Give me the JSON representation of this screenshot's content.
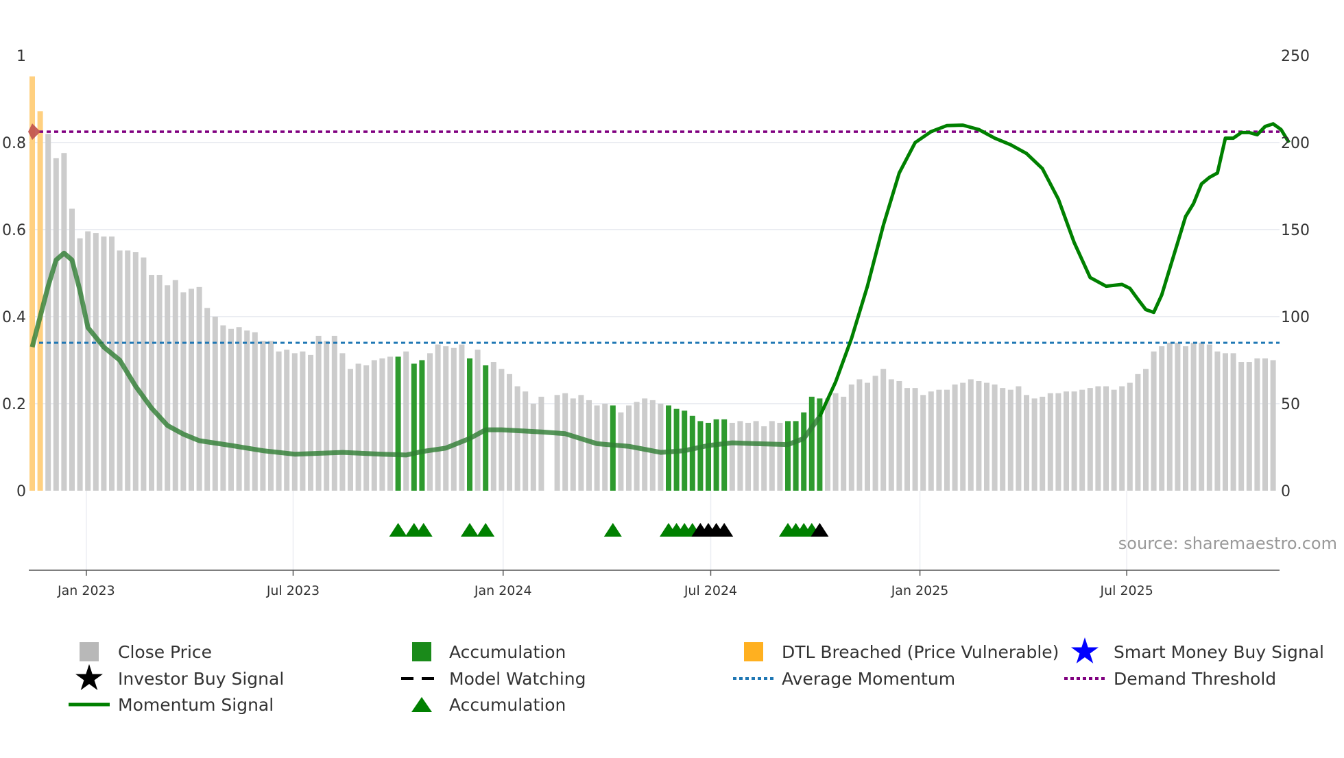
{
  "chart_data": {
    "type": "bar+line",
    "source": "source: sharemaestro.com",
    "left_axis": {
      "range": [
        0,
        1
      ],
      "ticks": [
        "0",
        "0.2",
        "0.4",
        "0.6",
        "0.8",
        "1"
      ],
      "tick_values": [
        0,
        0.2,
        0.4,
        0.6,
        0.8,
        1
      ]
    },
    "right_axis": {
      "range": [
        0,
        250
      ],
      "ticks": [
        "0",
        "50",
        "100",
        "150",
        "200",
        "250"
      ],
      "tick_values": [
        0,
        50,
        100,
        150,
        200,
        250
      ]
    },
    "x_ticks": [
      {
        "label": "Jan 2023",
        "week": 6.8
      },
      {
        "label": "Jul 2023",
        "week": 32.8
      },
      {
        "label": "Jan 2024",
        "week": 59.2
      },
      {
        "label": "Jul 2024",
        "week": 85.3
      },
      {
        "label": "Jan 2025",
        "week": 111.6
      },
      {
        "label": "Jul 2025",
        "week": 137.6
      }
    ],
    "close_price": [
      238,
      218,
      205,
      191,
      194,
      162,
      145,
      149,
      148,
      146,
      146,
      138,
      138,
      137,
      134,
      124,
      124,
      118,
      121,
      114,
      116,
      117,
      105,
      100,
      95,
      93,
      94,
      92,
      91,
      86,
      86,
      80,
      81,
      79,
      80,
      78,
      89,
      86,
      89,
      79,
      70,
      73,
      72,
      75,
      76,
      77,
      77,
      80,
      73,
      75,
      79,
      84,
      83,
      82,
      84,
      76,
      81,
      72,
      74,
      70,
      67,
      60,
      57,
      50,
      54,
      0,
      55,
      56,
      53,
      55,
      52,
      49,
      50,
      49,
      45,
      49,
      51,
      53,
      52,
      50,
      49,
      47,
      46,
      43,
      40,
      39,
      41,
      41,
      39,
      40,
      39,
      40,
      37,
      40,
      39,
      40,
      40,
      45,
      54,
      53,
      53,
      56,
      54,
      61,
      64,
      62,
      66,
      70,
      64,
      63,
      59,
      59,
      55,
      57,
      58,
      58,
      61,
      62,
      64,
      63,
      62,
      61,
      59,
      58,
      60,
      55,
      53,
      54,
      56,
      56,
      57,
      57,
      58,
      59,
      60,
      60,
      58,
      60,
      62,
      67,
      70,
      80,
      83,
      85,
      85,
      83,
      85,
      85,
      84,
      80,
      79,
      79,
      74,
      74,
      76,
      76,
      75
    ],
    "dtl_breached_weeks": [
      0,
      1
    ],
    "accumulation_weeks": [
      46,
      48,
      49,
      55,
      57,
      73,
      80,
      81,
      82,
      83,
      84,
      85,
      86,
      87,
      95,
      96,
      97,
      98,
      99
    ],
    "momentum_signal": [
      [
        0,
        0.33
      ],
      [
        2,
        0.47
      ],
      [
        3,
        0.53
      ],
      [
        4,
        0.546
      ],
      [
        5,
        0.53
      ],
      [
        6,
        0.46
      ],
      [
        7,
        0.375
      ],
      [
        9,
        0.33
      ],
      [
        11,
        0.3
      ],
      [
        13,
        0.24
      ],
      [
        15,
        0.19
      ],
      [
        17,
        0.15
      ],
      [
        19,
        0.13
      ],
      [
        21,
        0.115
      ],
      [
        25,
        0.104
      ],
      [
        29,
        0.092
      ],
      [
        33,
        0.084
      ],
      [
        39,
        0.088
      ],
      [
        44,
        0.084
      ],
      [
        47,
        0.082
      ],
      [
        49,
        0.09
      ],
      [
        52,
        0.098
      ],
      [
        55,
        0.12
      ],
      [
        57,
        0.14
      ],
      [
        59,
        0.14
      ],
      [
        64,
        0.135
      ],
      [
        67,
        0.131
      ],
      [
        71,
        0.108
      ],
      [
        75,
        0.102
      ],
      [
        79,
        0.088
      ],
      [
        82,
        0.092
      ],
      [
        85,
        0.104
      ],
      [
        88,
        0.11
      ],
      [
        91,
        0.108
      ],
      [
        95,
        0.106
      ],
      [
        97,
        0.12
      ],
      [
        99,
        0.17
      ],
      [
        101,
        0.25
      ],
      [
        103,
        0.35
      ],
      [
        105,
        0.47
      ],
      [
        107,
        0.61
      ],
      [
        109,
        0.73
      ],
      [
        111,
        0.8
      ],
      [
        113,
        0.825
      ],
      [
        115,
        0.839
      ],
      [
        117,
        0.84
      ],
      [
        119,
        0.83
      ],
      [
        121,
        0.81
      ],
      [
        123,
        0.795
      ],
      [
        125,
        0.775
      ],
      [
        127,
        0.74
      ],
      [
        129,
        0.67
      ],
      [
        131,
        0.57
      ],
      [
        133,
        0.49
      ],
      [
        135,
        0.47
      ],
      [
        137,
        0.474
      ],
      [
        138,
        0.465
      ],
      [
        139,
        0.44
      ],
      [
        140,
        0.416
      ],
      [
        141,
        0.41
      ],
      [
        142,
        0.45
      ],
      [
        143,
        0.51
      ],
      [
        144,
        0.57
      ],
      [
        145,
        0.63
      ],
      [
        146,
        0.66
      ],
      [
        147,
        0.705
      ],
      [
        148,
        0.72
      ],
      [
        149,
        0.73
      ],
      [
        150,
        0.81
      ],
      [
        151,
        0.81
      ],
      [
        152,
        0.823
      ],
      [
        153,
        0.823
      ],
      [
        154,
        0.818
      ],
      [
        155,
        0.837
      ],
      [
        156,
        0.843
      ],
      [
        157,
        0.83
      ],
      [
        158,
        0.8
      ]
    ],
    "average_momentum": 0.34,
    "demand_threshold": 0.825,
    "signal_markers": [
      {
        "week": 46,
        "type": "accumulation"
      },
      {
        "week": 48,
        "type": "accumulation"
      },
      {
        "week": 49.2,
        "type": "accumulation"
      },
      {
        "week": 55,
        "type": "accumulation"
      },
      {
        "week": 57,
        "type": "accumulation"
      },
      {
        "week": 73,
        "type": "accumulation"
      },
      {
        "week": 80,
        "type": "accumulation"
      },
      {
        "week": 81,
        "type": "accumulation"
      },
      {
        "week": 82,
        "type": "accumulation"
      },
      {
        "week": 83,
        "type": "accumulation"
      },
      {
        "week": 84,
        "type": "investor"
      },
      {
        "week": 85,
        "type": "investor"
      },
      {
        "week": 86,
        "type": "investor"
      },
      {
        "week": 87,
        "type": "investor"
      },
      {
        "week": 95,
        "type": "accumulation"
      },
      {
        "week": 96,
        "type": "accumulation"
      },
      {
        "week": 97,
        "type": "accumulation"
      },
      {
        "week": 98,
        "type": "accumulation"
      },
      {
        "week": 99,
        "type": "investor"
      }
    ],
    "legend": [
      {
        "label": "Close Price",
        "symbol": "square",
        "color": "#b8b8b8"
      },
      {
        "label": "Accumulation",
        "symbol": "square",
        "color": "#1a8a1a"
      },
      {
        "label": "DTL Breached (Price Vulnerable)",
        "symbol": "square",
        "color": "#ffb020"
      },
      {
        "label": "Smart Money Buy Signal",
        "symbol": "star",
        "color": "#0000ff"
      },
      {
        "label": "Investor Buy Signal",
        "symbol": "star",
        "color": "#000000"
      },
      {
        "label": "Model Watching",
        "symbol": "dash",
        "color": "#000000"
      },
      {
        "label": "Average Momentum",
        "symbol": "dot",
        "color": "#1f77b4"
      },
      {
        "label": "Demand Threshold",
        "symbol": "dot",
        "color": "#800080"
      },
      {
        "label": "Momentum Signal",
        "symbol": "line",
        "color": "#008000"
      },
      {
        "label": "Accumulation",
        "symbol": "triangle",
        "color": "#008000"
      }
    ],
    "colors": {
      "price": "#cccccc",
      "accum": "#2e9a2e",
      "dtl": "#ffd080",
      "momentum": "#008000",
      "avg": "#1f77b4",
      "threshold": "#800080",
      "grid": "#ebedf2"
    }
  }
}
